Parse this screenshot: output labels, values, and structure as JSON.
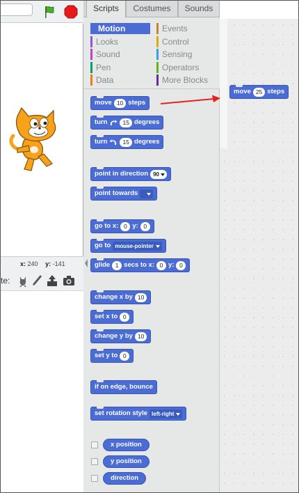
{
  "stage": {
    "coords": {
      "x_label": "x:",
      "x_value": "240",
      "y_label": "y:",
      "y_value": "-141"
    },
    "sprite_label": "te:"
  },
  "tabs": [
    {
      "label": "Scripts",
      "active": true
    },
    {
      "label": "Costumes",
      "active": false
    },
    {
      "label": "Sounds",
      "active": false
    }
  ],
  "categories": [
    {
      "label": "Motion",
      "color": "#4a6cd4",
      "selected": true
    },
    {
      "label": "Looks",
      "color": "#8a55d7",
      "selected": false
    },
    {
      "label": "Sound",
      "color": "#bb42c3",
      "selected": false
    },
    {
      "label": "Pen",
      "color": "#0e9a6c",
      "selected": false
    },
    {
      "label": "Data",
      "color": "#ee7d16",
      "selected": false
    },
    {
      "label": "Events",
      "color": "#c88330",
      "selected": false
    },
    {
      "label": "Control",
      "color": "#e1a91a",
      "selected": false
    },
    {
      "label": "Sensing",
      "color": "#2ca5e2",
      "selected": false
    },
    {
      "label": "Operators",
      "color": "#5cb712",
      "selected": false
    },
    {
      "label": "More Blocks",
      "color": "#632d99",
      "selected": false
    }
  ],
  "blocks": {
    "move": {
      "pre": "move",
      "value": "10",
      "post": "steps"
    },
    "turn_right": {
      "pre": "turn",
      "value": "15",
      "post": "degrees"
    },
    "turn_left": {
      "pre": "turn",
      "value": "15",
      "post": "degrees"
    },
    "point_direction": {
      "pre": "point in direction",
      "value": "90"
    },
    "point_towards": {
      "pre": "point towards",
      "value": ""
    },
    "go_to_xy": {
      "pre": "go to x:",
      "x": "0",
      "mid": "y:",
      "y": "0"
    },
    "go_to": {
      "pre": "go to",
      "value": "mouse-pointer"
    },
    "glide": {
      "pre": "glide",
      "secs": "1",
      "mid": "secs to x:",
      "x": "0",
      "mid2": "y:",
      "y": "0"
    },
    "change_x": {
      "pre": "change x by",
      "value": "10"
    },
    "set_x": {
      "pre": "set x to",
      "value": "0"
    },
    "change_y": {
      "pre": "change y by",
      "value": "10"
    },
    "set_y": {
      "pre": "set y to",
      "value": "0"
    },
    "bounce": {
      "label": "if on edge, bounce"
    },
    "rotation_style": {
      "pre": "set rotation style",
      "value": "left-right"
    },
    "reporters": [
      {
        "label": "x position"
      },
      {
        "label": "y position"
      },
      {
        "label": "direction"
      }
    ]
  },
  "script_area": {
    "placed_block": {
      "pre": "move",
      "value": "25",
      "post": "steps"
    },
    "arrow_color": "#e8201c"
  }
}
